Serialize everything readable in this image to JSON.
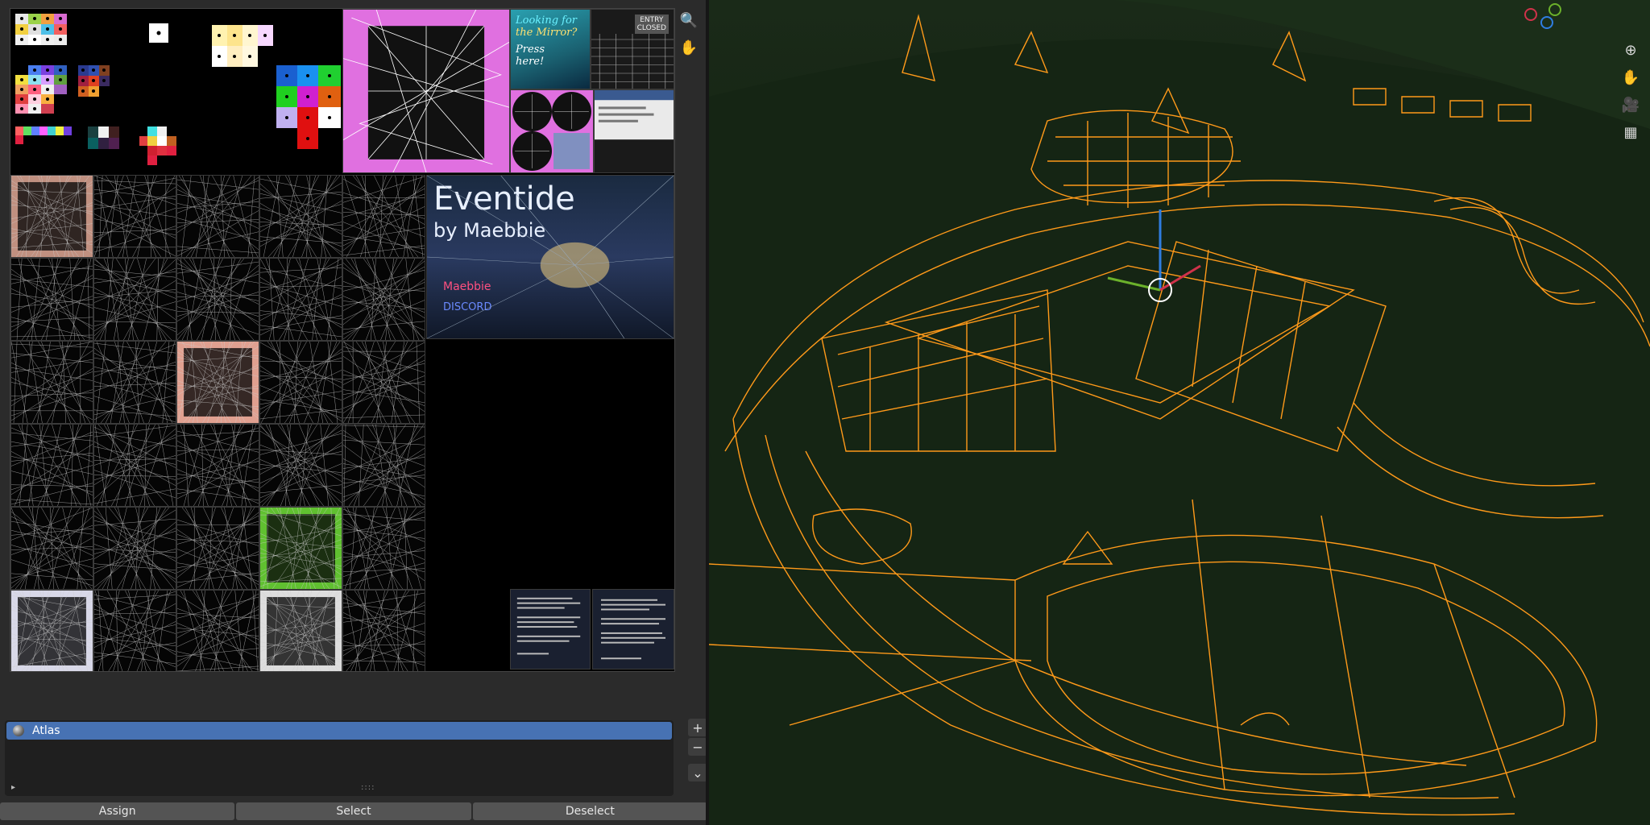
{
  "uv_editor": {
    "tiles": {
      "mirror_poster": {
        "lines": [
          "Looking for",
          "the Mirror?",
          "Press",
          "here!"
        ]
      },
      "entry_sign": {
        "lines": [
          "ENTRY",
          "CLOSED"
        ]
      },
      "event_poster": {
        "title": "Eventide",
        "subtitle": "by Maebbie",
        "credit1": "Maebbie",
        "credit2": "DISCORD"
      }
    },
    "tools": {
      "zoom": "🔍",
      "pan": "✋"
    }
  },
  "material_slots": {
    "items": [
      {
        "label": "Atlas",
        "selected": true
      }
    ],
    "add_label": "+",
    "remove_label": "−",
    "menu_label": "⌄",
    "expand_label": "▸",
    "grip_label": "::::"
  },
  "buttons": {
    "assign": "Assign",
    "select": "Select",
    "deselect": "Deselect"
  },
  "viewport_tools": {
    "zoom": "⊕",
    "pan": "✋",
    "camera": "🎥",
    "grid": "▦"
  },
  "colors": {
    "wire": "#ff9a1a",
    "selected_slot": "#4772b3",
    "axis_x": "#d0324a",
    "axis_y": "#6bb12b",
    "axis_z": "#2f7de1"
  }
}
